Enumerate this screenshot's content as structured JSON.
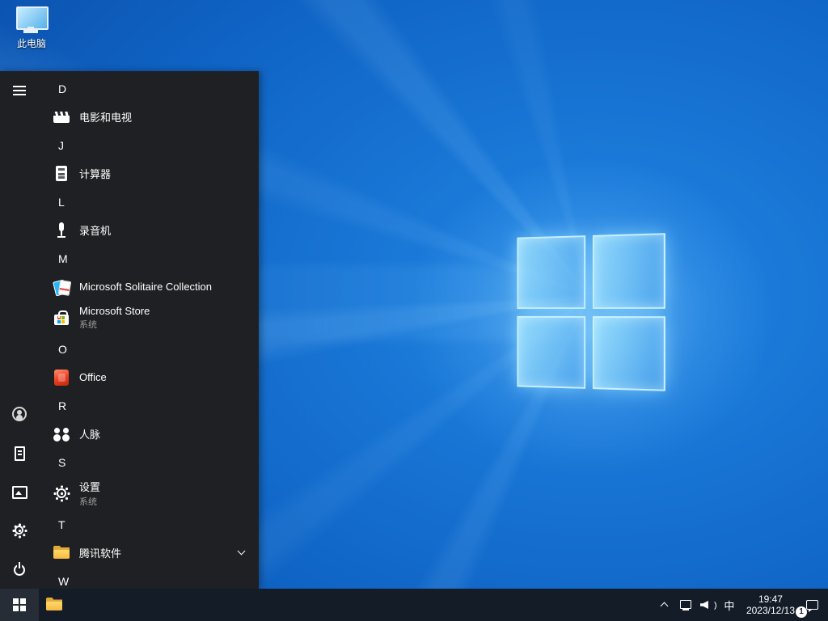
{
  "colors": {
    "wallpaper_deep": "#083a88",
    "wallpaper_mid": "#0f63c4",
    "wallpaper_light": "#2186e4",
    "hero_glow": "#aee4ff",
    "start_menu_bg": "#1f2023",
    "taskbar_bg": "#141c27",
    "text_primary": "#ffffff",
    "text_secondary": "#9d9d9d",
    "folder_yellow": "#ffd967",
    "ms_red": "#f25022",
    "ms_green": "#7fba00",
    "ms_blue": "#00a4ef",
    "ms_yellow": "#ffb900"
  },
  "desktop": {
    "this_pc": {
      "label": "此电脑",
      "icon": "computer"
    }
  },
  "start_menu": {
    "hamburger_icon": "hamburger-menu",
    "sections": [
      {
        "letter": "D",
        "apps": [
          {
            "name": "电影和电视",
            "icon": "movies-tv"
          }
        ]
      },
      {
        "letter": "J",
        "apps": [
          {
            "name": "计算器",
            "icon": "calculator"
          }
        ]
      },
      {
        "letter": "L",
        "apps": [
          {
            "name": "录音机",
            "icon": "voice-recorder"
          }
        ]
      },
      {
        "letter": "M",
        "apps": [
          {
            "name": "Microsoft Solitaire Collection",
            "icon": "solitaire"
          },
          {
            "name": "Microsoft Store",
            "subtitle": "系统",
            "icon": "store"
          }
        ]
      },
      {
        "letter": "O",
        "apps": [
          {
            "name": "Office",
            "icon": "office"
          }
        ]
      },
      {
        "letter": "R",
        "apps": [
          {
            "name": "人脉",
            "icon": "people"
          }
        ]
      },
      {
        "letter": "S",
        "apps": [
          {
            "name": "设置",
            "subtitle": "系统",
            "icon": "settings"
          }
        ]
      },
      {
        "letter": "T",
        "apps": [
          {
            "name": "腾讯软件",
            "icon": "folder",
            "expandable": true
          }
        ]
      },
      {
        "letter": "W",
        "apps": []
      }
    ],
    "rail_bottom": [
      {
        "icon": "user-account"
      },
      {
        "icon": "documents"
      },
      {
        "icon": "pictures"
      },
      {
        "icon": "settings-gear"
      },
      {
        "icon": "power"
      }
    ]
  },
  "taskbar": {
    "start_icon": "windows-logo",
    "pinned": [
      {
        "icon": "file-explorer"
      }
    ],
    "tray": {
      "chevron_icon": "chevron-up",
      "network_icon": "display-network",
      "volume_icon": "speaker",
      "ime": "中",
      "time": "19:47",
      "date": "2023/12/13",
      "action_center_icon": "notification-bubble",
      "badge": "1"
    }
  }
}
